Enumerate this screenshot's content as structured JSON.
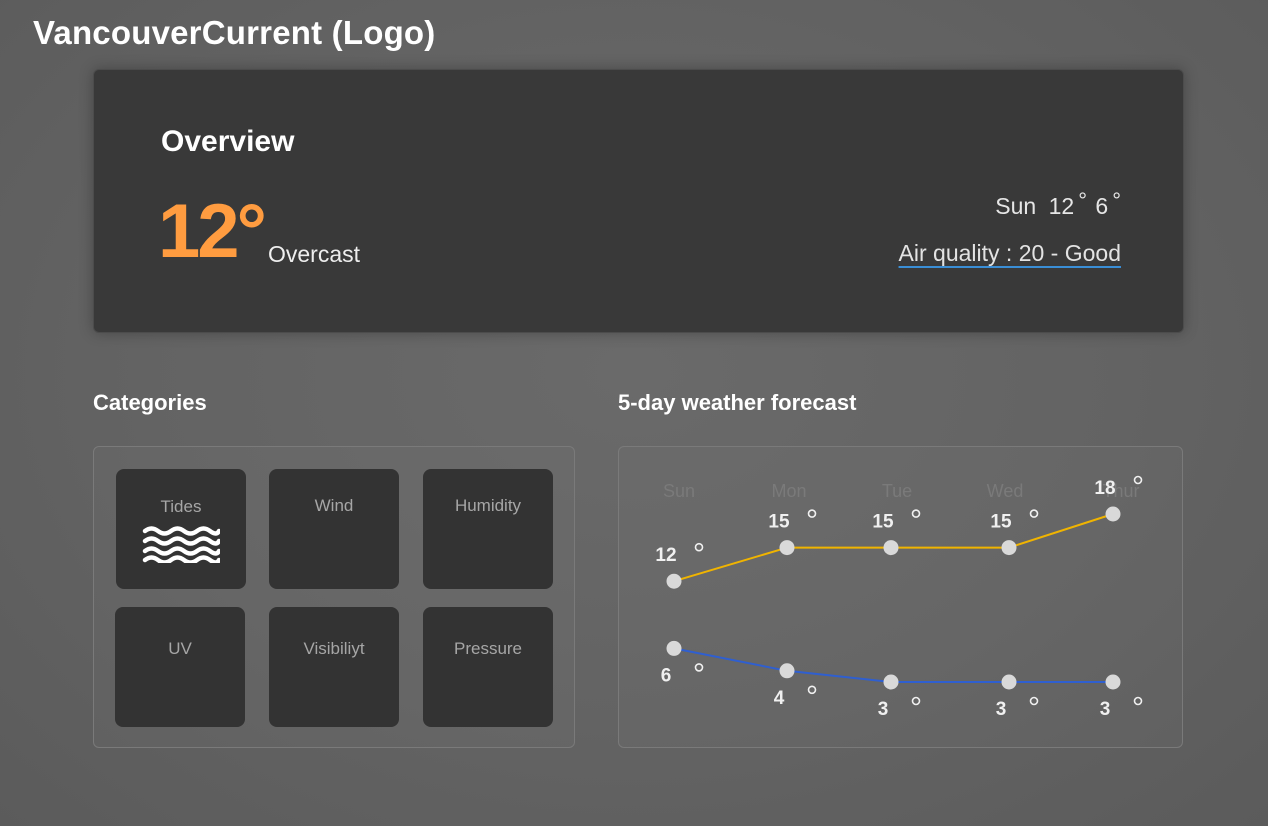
{
  "app": {
    "logo_text": "VancouverCurrent (Logo)"
  },
  "overview": {
    "title": "Overview",
    "temperature": "12°",
    "condition": "Overcast",
    "day_label": "Sun",
    "high": "12",
    "low": "6",
    "degree_symbol": "°",
    "air_quality": "Air quality : 20 - Good"
  },
  "categories": {
    "title": "Categories",
    "items": [
      {
        "label": "Tides",
        "icon": "waves-icon"
      },
      {
        "label": "Wind",
        "icon": ""
      },
      {
        "label": "Humidity",
        "icon": ""
      },
      {
        "label": "UV",
        "icon": ""
      },
      {
        "label": "Visibiliyt",
        "icon": ""
      },
      {
        "label": "Pressure",
        "icon": ""
      }
    ]
  },
  "forecast": {
    "title": "5-day weather forecast"
  },
  "chart_data": {
    "type": "line",
    "categories": [
      "Sun",
      "Mon",
      "Tue",
      "Wed",
      "Thur"
    ],
    "series": [
      {
        "name": "",
        "values": [
          12,
          15,
          15,
          15,
          18
        ],
        "color": "#f0b400"
      },
      {
        "name": "",
        "values": [
          6,
          4,
          3,
          3,
          3
        ],
        "color": "#2f5fd0"
      }
    ],
    "value_suffix": "°",
    "grid": false
  },
  "colors": {
    "accent_temp": "#ff9c40",
    "high_line": "#f0b400",
    "low_line": "#2f5fd0",
    "link_underline": "#3a8ed6"
  }
}
